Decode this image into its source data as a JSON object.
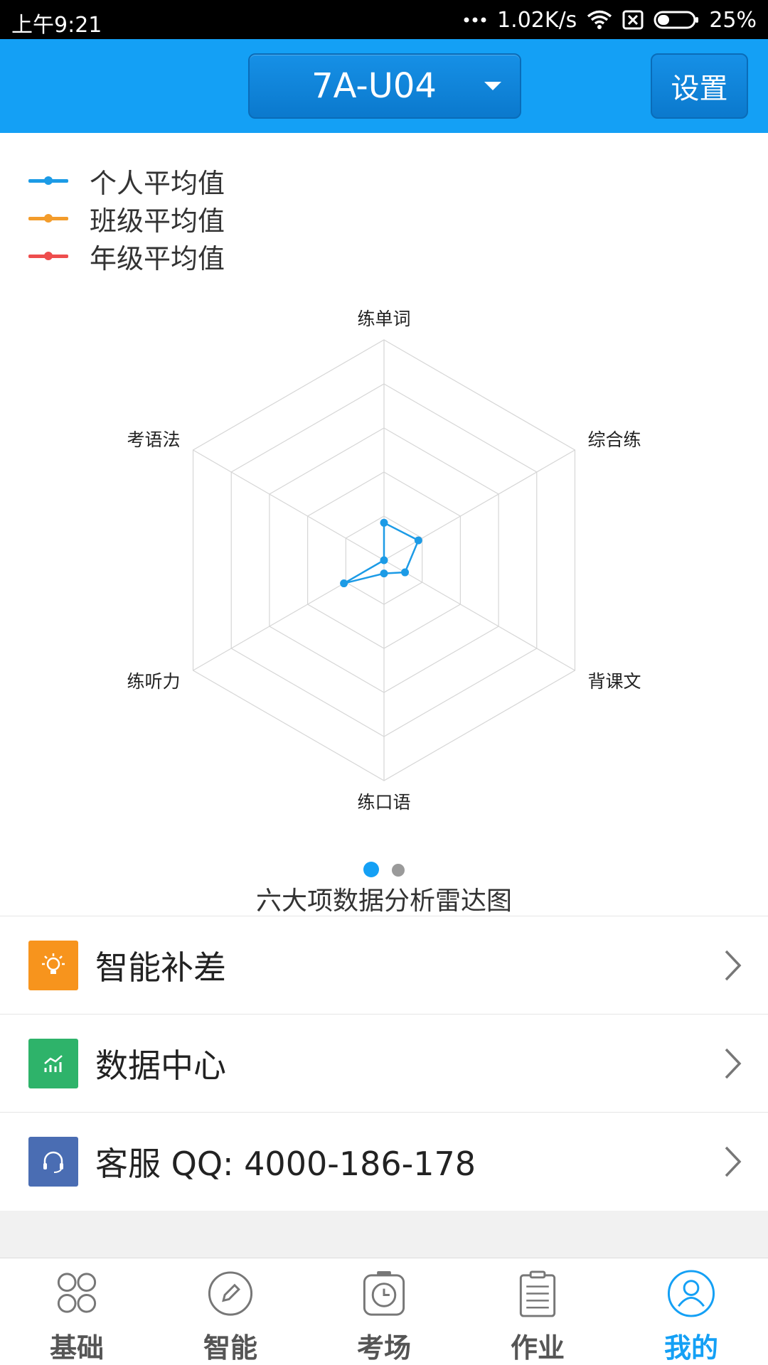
{
  "status_bar": {
    "time": "上午9:21",
    "speed": "1.02K/s",
    "battery": "25%"
  },
  "header": {
    "unit_selector": "7A-U04",
    "settings_label": "设置"
  },
  "legend": [
    {
      "label": "个人平均值",
      "color": "#1c9be6"
    },
    {
      "label": "班级平均值",
      "color": "#f39c2b"
    },
    {
      "label": "年级平均值",
      "color": "#ee4d4d"
    }
  ],
  "chart_data": {
    "type": "radar",
    "axes": [
      "练单词",
      "综合练",
      "背课文",
      "练口语",
      "练听力",
      "考语法"
    ],
    "levels": 5,
    "max": 100,
    "series": [
      {
        "name": "个人平均值",
        "color": "#1c9be6",
        "values": [
          17,
          18,
          11,
          6,
          21,
          0
        ]
      }
    ],
    "caption": "六大项数据分析雷达图"
  },
  "pager": {
    "pages": 2,
    "active": 0
  },
  "list": [
    {
      "label": "智能补差",
      "icon": "lightbulb-icon",
      "color": "#f7941d"
    },
    {
      "label": "数据中心",
      "icon": "chart-icon",
      "color": "#2eb36a"
    },
    {
      "label": "客服 QQ: 4000-186-178",
      "icon": "headset-icon",
      "color": "#4a6db3"
    }
  ],
  "bottom_nav": [
    {
      "label": "基础",
      "icon": "grid-icon"
    },
    {
      "label": "智能",
      "icon": "pencil-icon"
    },
    {
      "label": "考场",
      "icon": "clock-icon"
    },
    {
      "label": "作业",
      "icon": "clipboard-icon"
    },
    {
      "label": "我的",
      "icon": "user-icon",
      "active": true
    }
  ]
}
